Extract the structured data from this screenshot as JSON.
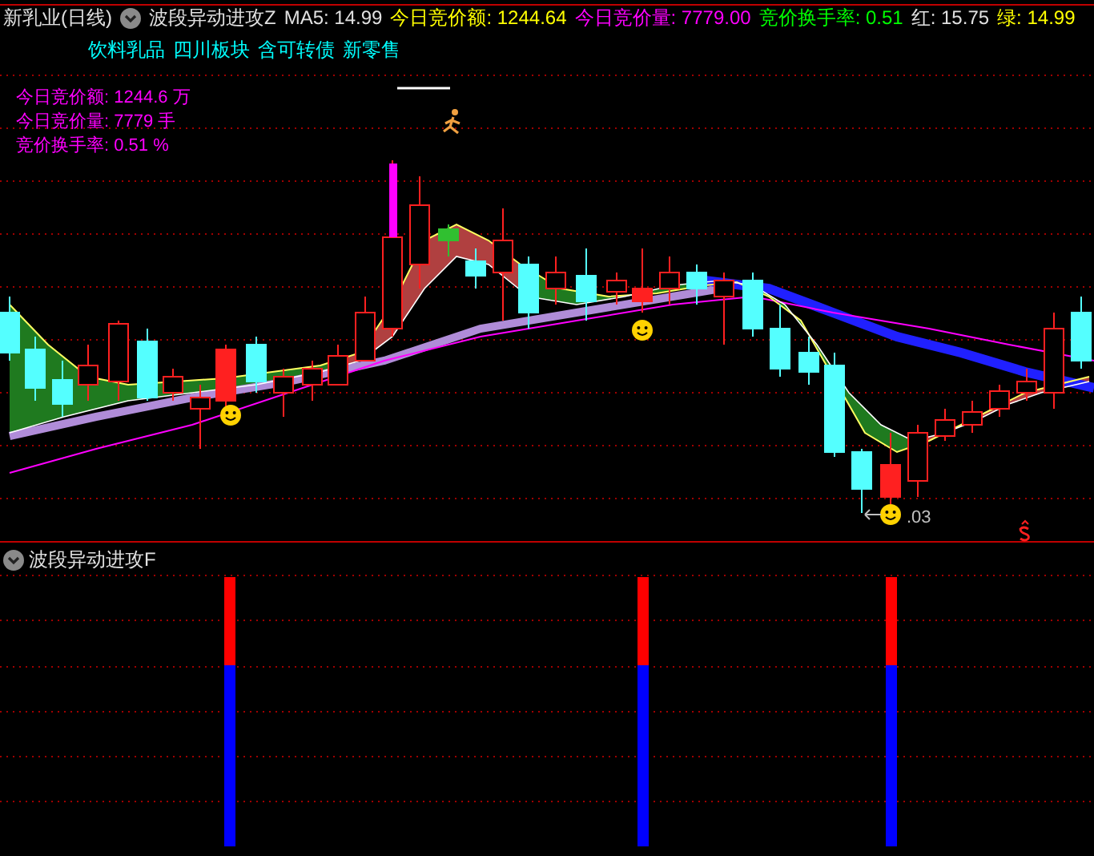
{
  "header": {
    "title": "新乳业(日线)",
    "indicator": "波段异动进攻Z",
    "values": [
      {
        "label": "MA5:",
        "value": "14.99",
        "color": "#e0e0e0"
      },
      {
        "label": "今日竞价额:",
        "value": "1244.64",
        "color": "#ffff00"
      },
      {
        "label": "今日竞价量:",
        "value": "7779.00",
        "color": "#ff00ff"
      },
      {
        "label": "竞价换手率:",
        "value": "0.51",
        "color": "#00ff00"
      },
      {
        "label": "红:",
        "value": "15.75",
        "color": "#e0e0e0"
      },
      {
        "label": "绿:",
        "value": "14.99",
        "color": "#ffff00"
      }
    ]
  },
  "sectors": [
    "饮料乳品",
    "四川板块",
    "含可转债",
    "新零售"
  ],
  "stats": [
    "今日竞价额: 1244.6 万",
    "今日竞价量: 7779 手",
    "竞价换手率: 0.51 %"
  ],
  "low_label": ".03",
  "lower_panel": {
    "indicator": "波段异动进攻F"
  }
}
